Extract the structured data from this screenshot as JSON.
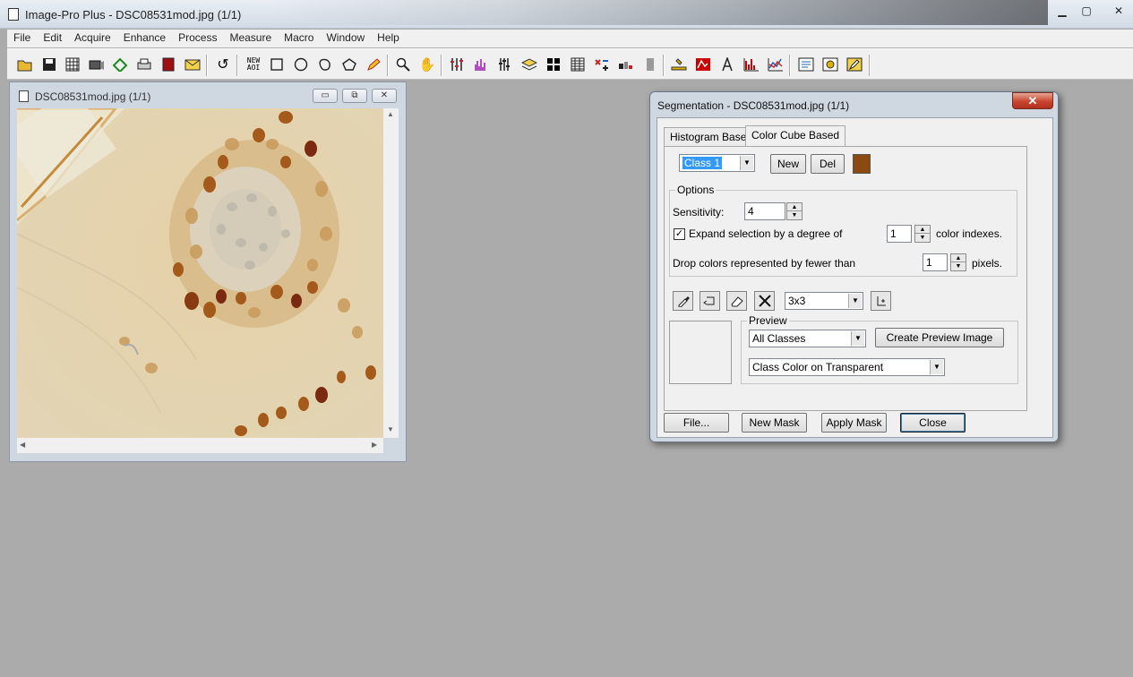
{
  "app": {
    "title": "Image-Pro Plus - DSC08531mod.jpg (1/1)",
    "window_buttons": {
      "minimize": "▁",
      "maximize": "▢",
      "close": "✕"
    }
  },
  "menu": [
    "File",
    "Edit",
    "Acquire",
    "Enhance",
    "Process",
    "Measure",
    "Macro",
    "Window",
    "Help"
  ],
  "toolbar": {
    "new_aoi_label_1": "NEW",
    "new_aoi_label_2": "AOI",
    "icons": [
      "open-icon",
      "save-icon",
      "grid-icon",
      "camera-icon",
      "scanner-icon",
      "print-icon",
      "book-icon",
      "mail-icon",
      "undo-icon",
      "rect-aoi-icon",
      "ellipse-aoi-icon",
      "irregular-aoi-icon",
      "polygon-aoi-icon",
      "pencil-icon",
      "zoom-icon",
      "hand-icon",
      "levels-icon",
      "histogram-icon",
      "sliders-icon",
      "layers-icon",
      "quad-icon",
      "table-icon",
      "xy-icon",
      "count-icon",
      "gauge-icon",
      "measure-icon",
      "stats-icon",
      "caliper-icon",
      "profile-icon",
      "chart-icon",
      "script-icon",
      "macro-icon",
      "edit-icon"
    ]
  },
  "image_window": {
    "title": "DSC08531mod.jpg (1/1)",
    "buttons": {
      "minimize": "▭",
      "restore": "⧉",
      "close": "✕"
    }
  },
  "dialog": {
    "title": "Segmentation - DSC08531mod.jpg (1/1)",
    "close_label": "✕",
    "tabs": [
      {
        "label": "Histogram Based",
        "active": false
      },
      {
        "label": "Color Cube Based",
        "active": true
      }
    ],
    "class_combo": "Class 1",
    "new_button": "New",
    "del_button": "Del",
    "class_color": "#8b4a0f",
    "options": {
      "group_label": "Options",
      "sensitivity_label": "Sensitivity:",
      "sensitivity_value": "4",
      "expand_checked": true,
      "expand_label": "Expand selection by a degree of",
      "expand_value": "1",
      "expand_suffix": "color indexes.",
      "drop_label": "Drop colors represented by fewer than",
      "drop_value": "1",
      "drop_suffix": "pixels."
    },
    "tools": [
      "dropper-icon",
      "undo-icon",
      "eraser-icon",
      "cross-icon"
    ],
    "kernel_combo": "3x3",
    "preview": {
      "group_label": "Preview",
      "classes_combo": "All Classes",
      "create_button": "Create Preview Image",
      "mode_combo": "Class Color on Transparent"
    },
    "footer": {
      "file_button": "File...",
      "new_mask_button": "New Mask",
      "apply_mask_button": "Apply Mask",
      "close_button": "Close"
    }
  }
}
